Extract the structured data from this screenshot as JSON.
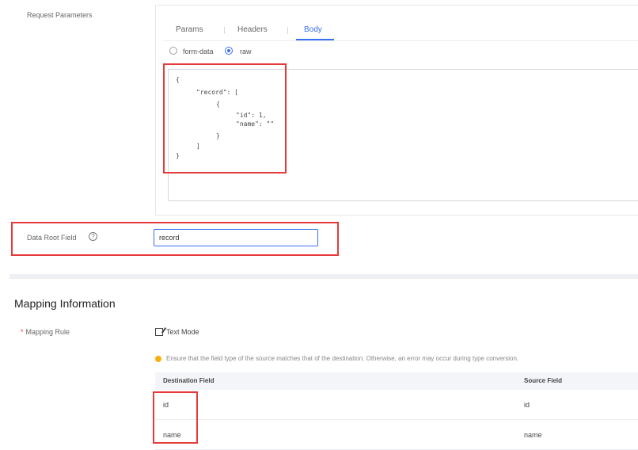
{
  "request": {
    "section_label": "Request Parameters",
    "tabs": [
      {
        "label": "Params",
        "active": false
      },
      {
        "label": "Headers",
        "active": false
      },
      {
        "label": "Body",
        "active": true
      }
    ],
    "body_mode": {
      "options": [
        {
          "label": "form-data",
          "checked": false
        },
        {
          "label": "raw",
          "checked": true
        }
      ]
    },
    "code_lines": [
      "{",
      "\"record\": [",
      "{",
      "\"id\": 1,",
      "\"name\": \"\"",
      "}",
      "]",
      "}"
    ]
  },
  "data_root": {
    "label": "Data Root Field",
    "help_icon": "question-circle-icon",
    "value": "record"
  },
  "mapping": {
    "title": "Mapping Information",
    "rule_label": "Mapping Rule",
    "text_mode_label": "Text Mode",
    "text_mode_icon": "edit-icon",
    "warning": "Ensure that the field type of the source matches that of the destination. Otherwise, an error may occur during type conversion.",
    "columns": [
      "Destination Field",
      "Source Field"
    ],
    "rows": [
      {
        "destination": "id",
        "source": "id"
      },
      {
        "destination": "name",
        "source": "name"
      }
    ]
  },
  "colors": {
    "accent": "#3a6ff2",
    "highlight_box": "#e53a3a",
    "warning": "#f5b10a"
  }
}
